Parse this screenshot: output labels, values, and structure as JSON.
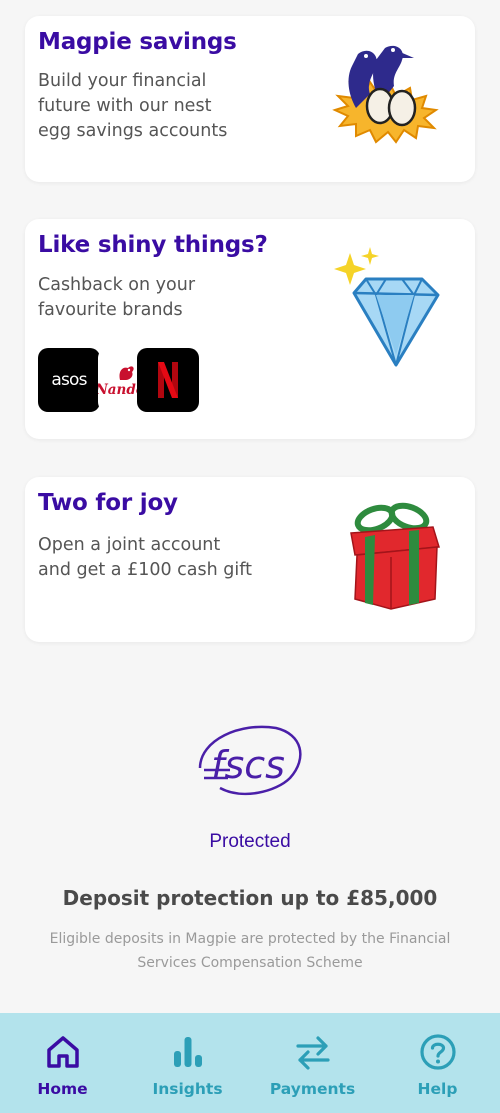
{
  "cards": [
    {
      "title": "Magpie savings",
      "body": "Build your financial\nfuture with our nest\negg savings accounts",
      "illustration": "magpies-on-nest-icon"
    },
    {
      "title": "Like shiny things?",
      "body": "Cashback on your\nfavourite brands",
      "illustration": "diamond-icon",
      "brands": [
        {
          "name": "asos",
          "label": "asos"
        },
        {
          "name": "nandos",
          "label": "Nando's"
        },
        {
          "name": "netflix",
          "label": "N"
        }
      ]
    },
    {
      "title": "Two for joy",
      "body": "Open a joint account\nand get a £100 cash gift",
      "illustration": "gift-box-icon"
    }
  ],
  "protection": {
    "logo_text": "fscs",
    "protected_label": "Protected",
    "title": "Deposit protection up to £85,000",
    "description": "Eligible deposits in Magpie are protected by the Financial Services Compensation Scheme"
  },
  "tabbar": {
    "tabs": [
      {
        "label": "Home",
        "icon": "home-icon",
        "active": true
      },
      {
        "label": "Insights",
        "icon": "bar-chart-icon",
        "active": false
      },
      {
        "label": "Payments",
        "icon": "transfer-arrows-icon",
        "active": false
      },
      {
        "label": "Help",
        "icon": "question-circle-icon",
        "active": false
      }
    ]
  },
  "colors": {
    "brand_purple": "#3a0ca3",
    "tabbar_bg": "#b3e3ec",
    "tab_inactive": "#2c9fb7",
    "page_bg": "#f6f6f6"
  }
}
